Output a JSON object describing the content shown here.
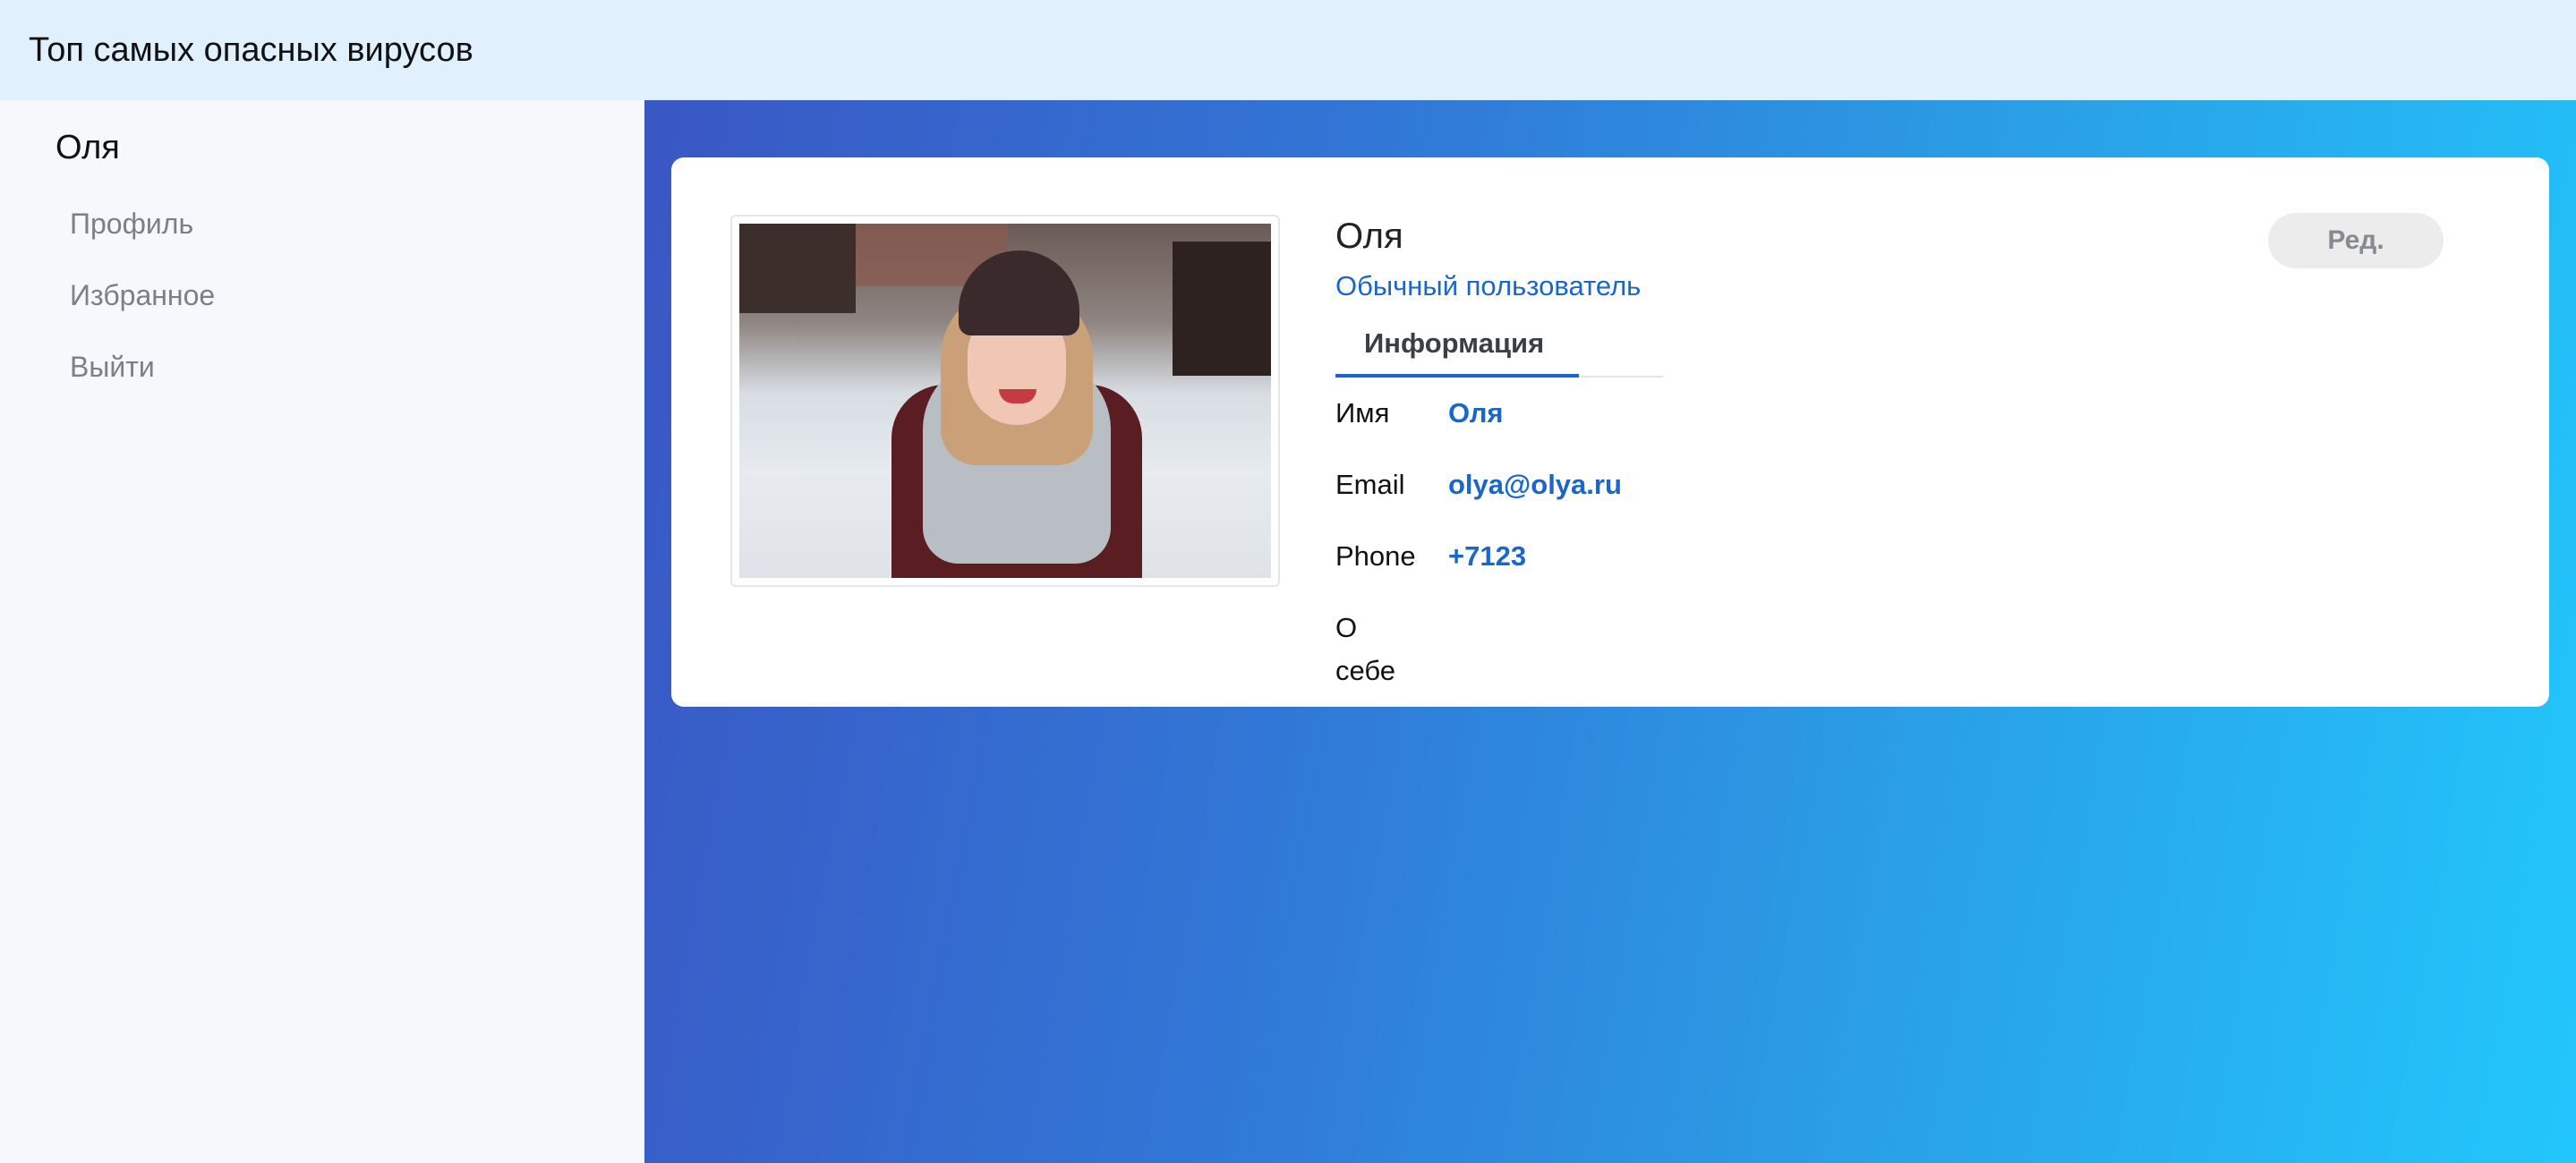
{
  "header": {
    "title": "Топ самых опасных вирусов"
  },
  "sidebar": {
    "user_name": "Оля",
    "items": [
      {
        "label": "Профиль"
      },
      {
        "label": "Избранное"
      },
      {
        "label": "Выйти"
      }
    ]
  },
  "profile": {
    "name": "Оля",
    "role": "Обычный пользователь",
    "edit_label": "Ред.",
    "tabs": [
      {
        "label": "Информация",
        "active": true
      }
    ],
    "fields": [
      {
        "label": "Имя",
        "value": "Оля"
      },
      {
        "label": "Email",
        "value": "olya@olya.ru"
      },
      {
        "label": "Phone",
        "value": "+7123"
      },
      {
        "label": "О себе",
        "value": ""
      }
    ]
  },
  "colors": {
    "header_bg": "#e1f0fd",
    "sidebar_bg": "#f7f8fb",
    "accent": "#1a66c9",
    "gradient_start": "#3a57c4",
    "gradient_end": "#22c7fc"
  }
}
